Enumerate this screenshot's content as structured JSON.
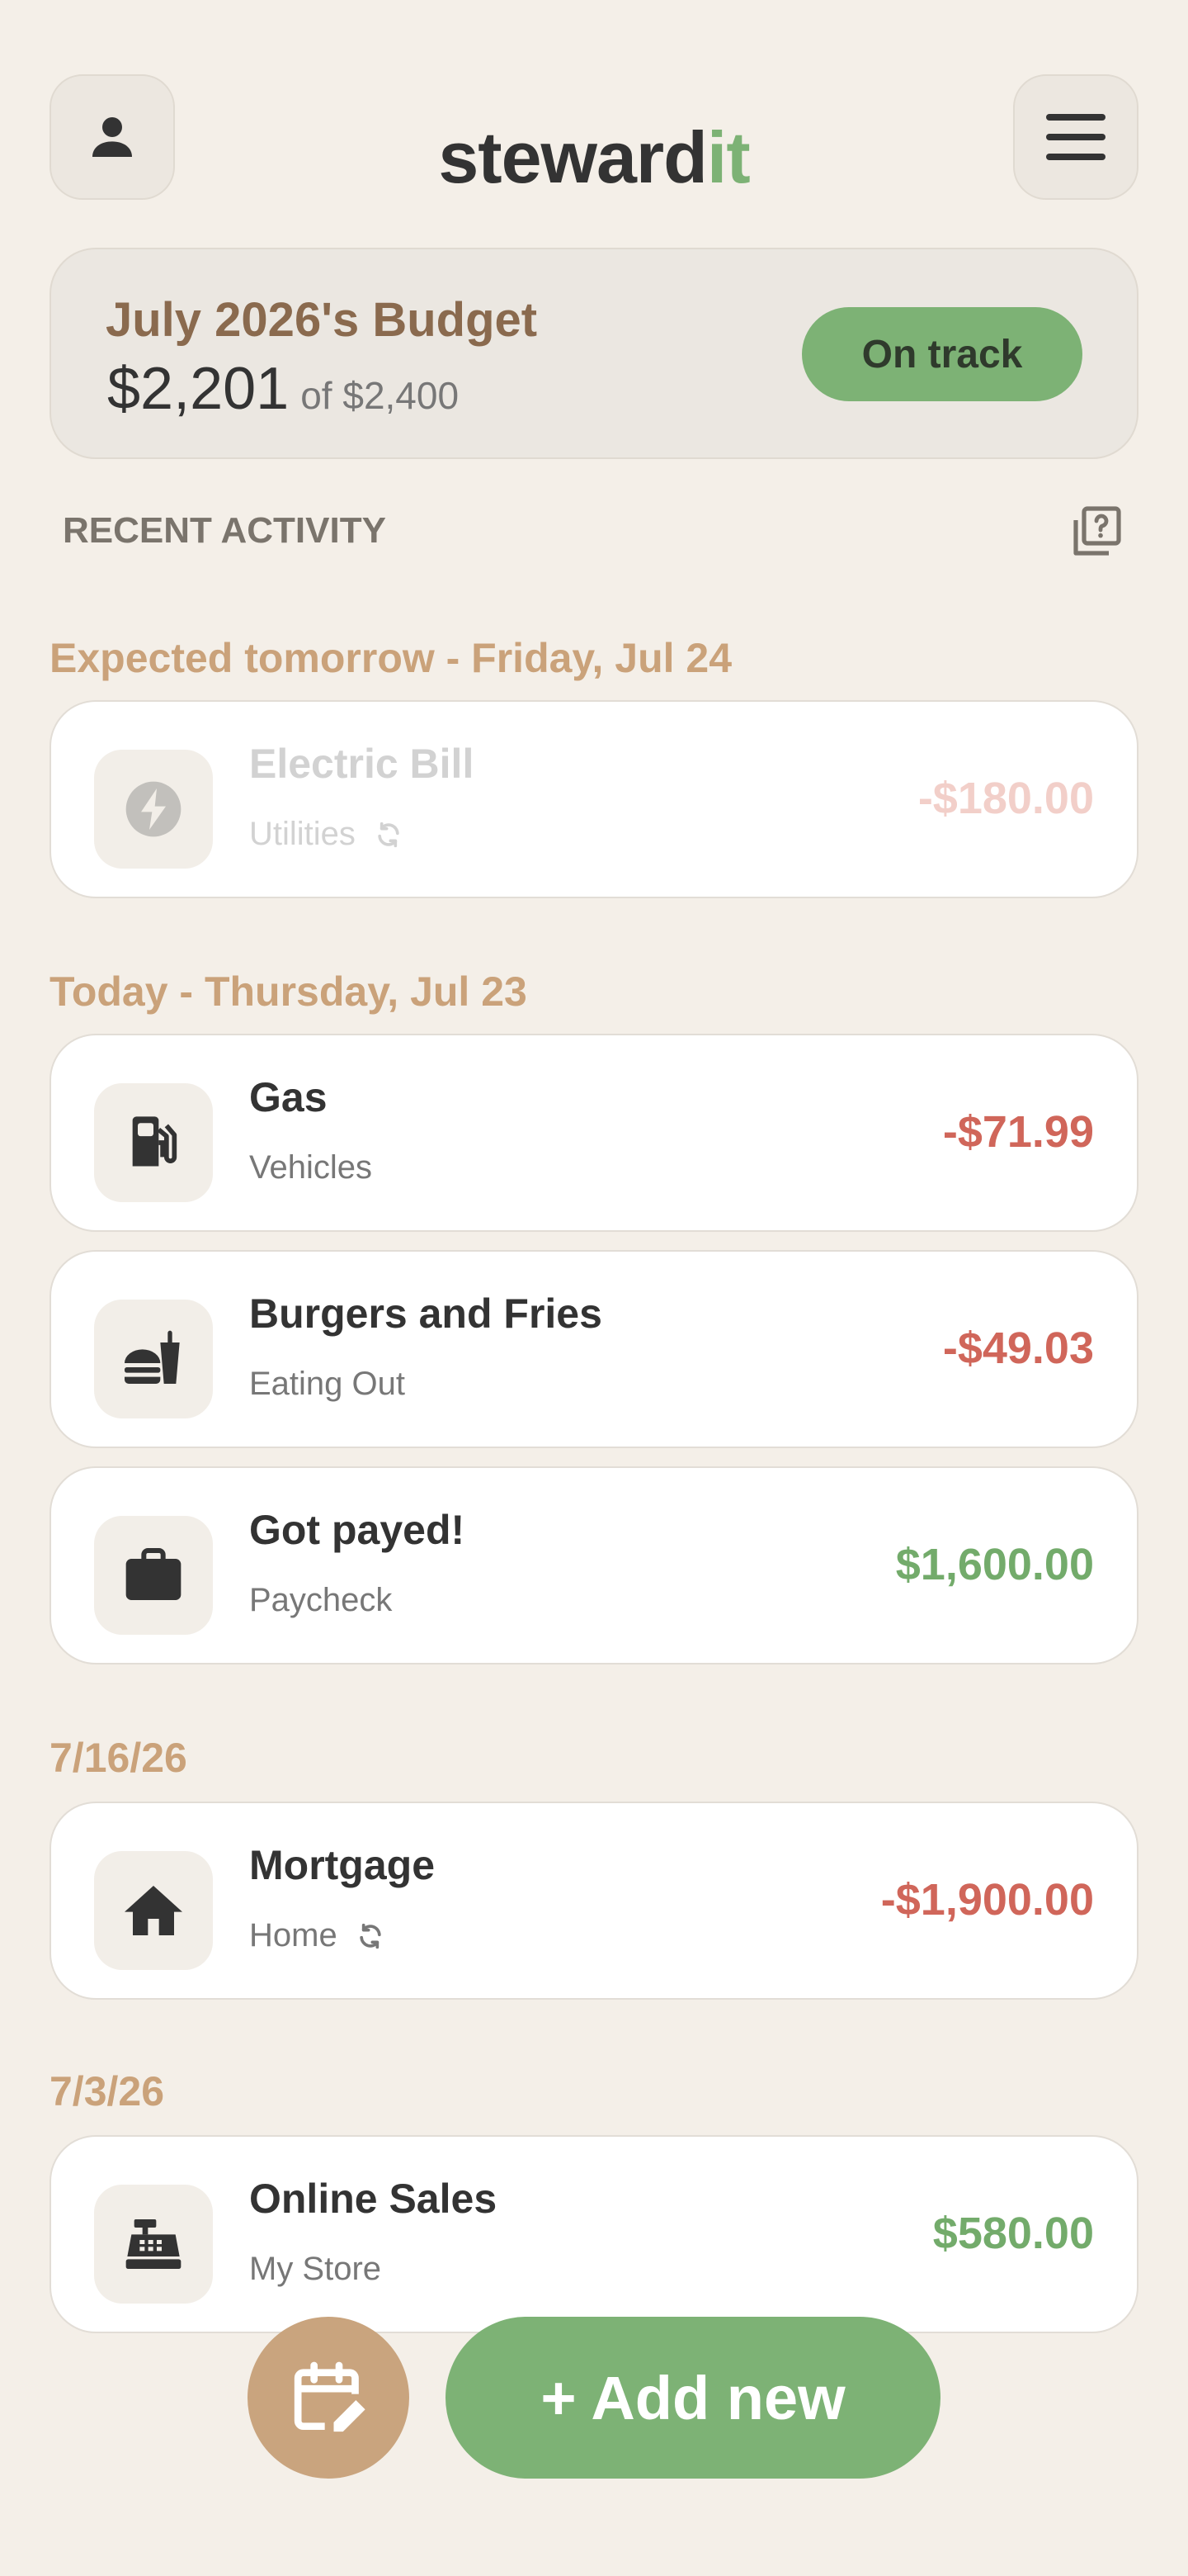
{
  "header": {
    "logo_main": "steward",
    "logo_accent": "it",
    "profile_icon": "person-icon",
    "menu_icon": "hamburger-menu-icon"
  },
  "budget": {
    "title": "July 2026's Budget",
    "spent": "$2,201",
    "of_total": "of $2,400",
    "status": "On track"
  },
  "recent_activity": {
    "label": "RECENT ACTIVITY",
    "help_icon": "help-square-icon"
  },
  "groups": [
    {
      "label": "Expected tomorrow - Friday, Jul 24",
      "items": [
        {
          "name": "Electric Bill",
          "category": "Utilities",
          "amount": "-$180.00",
          "icon": "lightning-bolt-icon",
          "recurring": true
        }
      ]
    },
    {
      "label": "Today - Thursday, Jul 23",
      "items": [
        {
          "name": "Gas",
          "category": "Vehicles",
          "amount": "-$71.99",
          "icon": "gas-pump-icon"
        },
        {
          "name": "Burgers and Fries",
          "category": "Eating Out",
          "amount": "-$49.03",
          "icon": "burger-drink-icon"
        },
        {
          "name": "Got payed!",
          "category": "Paycheck",
          "amount": "$1,600.00",
          "icon": "briefcase-icon"
        }
      ]
    },
    {
      "label": "7/16/26",
      "items": [
        {
          "name": "Mortgage",
          "category": "Home",
          "amount": "-$1,900.00",
          "icon": "house-icon",
          "recurring": true
        }
      ]
    },
    {
      "label": "7/3/26",
      "items": [
        {
          "name": "Online Sales",
          "category": "My Store",
          "amount": "$580.00",
          "icon": "cash-register-icon"
        }
      ]
    }
  ],
  "actions": {
    "calendar_icon": "calendar-edit-icon",
    "add_label": "+ Add new"
  },
  "colors": {
    "background": "#f4efe8",
    "accent_green": "#7db275",
    "accent_tan": "#c9a47e",
    "negative": "#d0665a",
    "positive": "#73ab6b"
  }
}
